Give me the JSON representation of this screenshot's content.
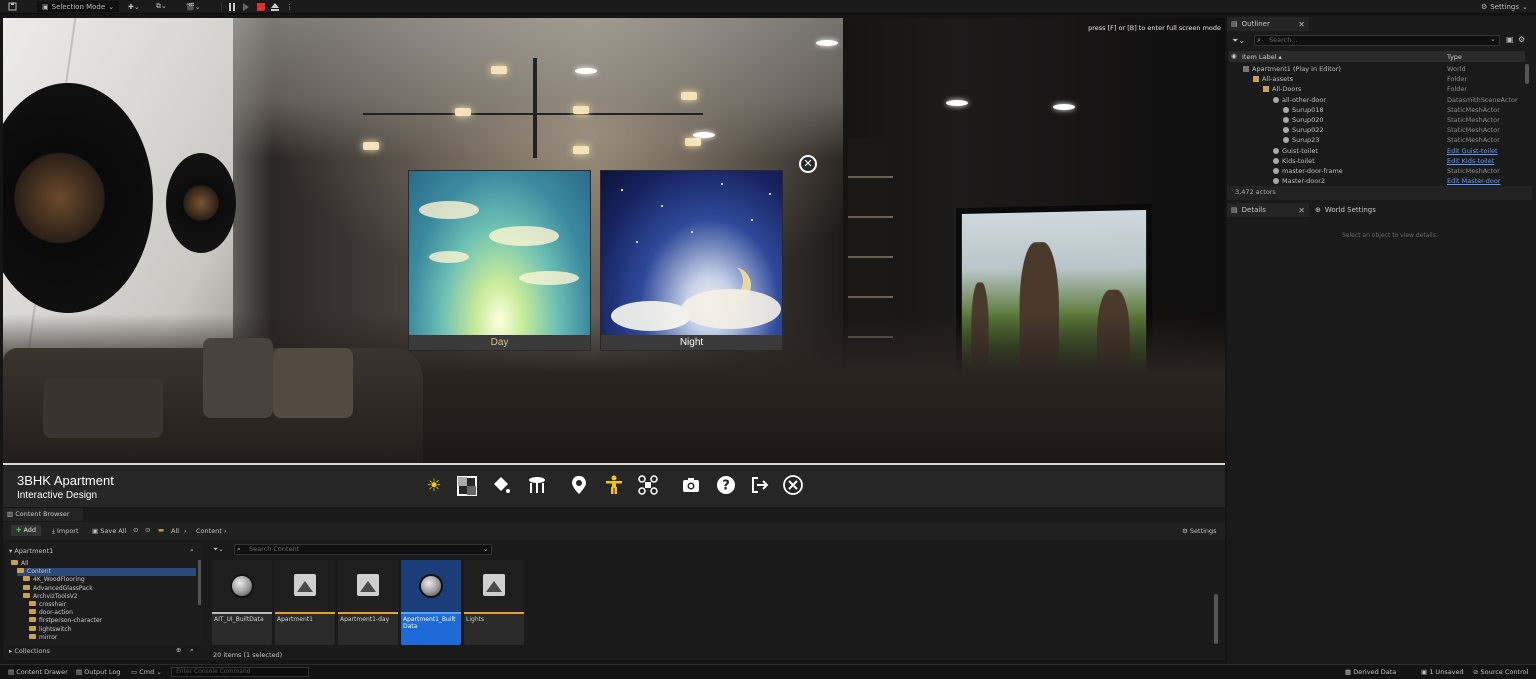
{
  "toolbar": {
    "mode": "Selection Mode",
    "settings": "Settings"
  },
  "viewport": {
    "hint": "press [F] or [B] to enter full screen mode",
    "day_label": "Day",
    "night_label": "Night"
  },
  "app": {
    "title": "3BHK Apartment",
    "subtitle": "Interactive Design",
    "icons": [
      "sun-icon",
      "material-icon",
      "paint-bucket-icon",
      "stool-icon",
      "location-pin-icon",
      "person-icon",
      "drone-icon",
      "camera-icon",
      "help-icon",
      "exit-icon",
      "close-icon"
    ]
  },
  "outliner": {
    "title": "Outliner",
    "search_placeholder": "Search...",
    "col_label": "Item Label ▴",
    "col_type": "Type",
    "rows": [
      {
        "label": "Apartment1 (Play in Editor)",
        "type": "World",
        "link": false
      },
      {
        "label": "All-assets",
        "type": "Folder",
        "link": false
      },
      {
        "label": "All-Doors",
        "type": "Folder",
        "link": false
      },
      {
        "label": "all-other-door",
        "type": "DatasmithSceneActor",
        "link": false
      },
      {
        "label": "Surup018",
        "type": "StaticMeshActor",
        "link": false
      },
      {
        "label": "Surup020",
        "type": "StaticMeshActor",
        "link": false
      },
      {
        "label": "Surup022",
        "type": "StaticMeshActor",
        "link": false
      },
      {
        "label": "Surup23",
        "type": "StaticMeshActor",
        "link": false
      },
      {
        "label": "Guist-toilet",
        "type": "Edit Guist-toilet",
        "link": true
      },
      {
        "label": "Kids-toilet",
        "type": "Edit Kids-toilet",
        "link": true
      },
      {
        "label": "master-door-frame",
        "type": "StaticMeshActor",
        "link": false
      },
      {
        "label": "Master-door2",
        "type": "Edit Master-door",
        "link": true
      }
    ],
    "actor_count": "3,472 actors"
  },
  "details": {
    "tab1": "Details",
    "tab2": "World Settings",
    "empty_msg": "Select an object to view details."
  },
  "content_browser": {
    "tab": "Content Browser",
    "add": "Add",
    "import": "Import",
    "save_all": "Save All",
    "crumb_all": "All",
    "crumb_content": "Content",
    "settings": "Settings",
    "project": "Apartment1",
    "search_placeholder": "Search Content",
    "folders": [
      "All",
      "Content",
      "4K_WoodFlooring",
      "AdvancedGlassPack",
      "ArchvizToolsV2",
      "crosshair",
      "door-action",
      "firstperson-character",
      "lightswitch",
      "mirror"
    ],
    "collections": "Collections",
    "assets": [
      {
        "name": "AIT_UI_BuiltData",
        "kind": "sphere",
        "strip": "#bcbcbc"
      },
      {
        "name": "Apartment1",
        "kind": "tex",
        "strip": "#e3a326"
      },
      {
        "name": "Apartment1-day",
        "kind": "tex",
        "strip": "#e3a326"
      },
      {
        "name": "Apartment1_Built Data",
        "kind": "sphere",
        "strip": "#5aa0ff"
      },
      {
        "name": "Lights",
        "kind": "tex",
        "strip": "#e3a326"
      }
    ],
    "count": "20 items (1 selected)"
  },
  "status": {
    "drawer": "Content Drawer",
    "output_log": "Output Log",
    "cmd": "Cmd",
    "cmd_placeholder": "Enter Console Command",
    "derived": "Derived Data",
    "unsaved": "1 Unsaved",
    "source": "Source Control"
  }
}
